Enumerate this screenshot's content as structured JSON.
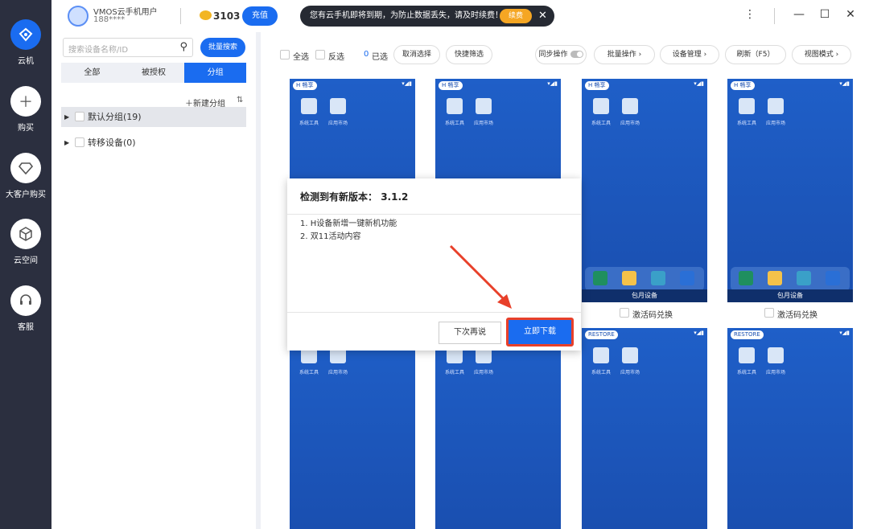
{
  "rail": {
    "items": [
      {
        "label": "云机",
        "icon": "cloud-phone-icon"
      },
      {
        "label": "购买",
        "icon": "plus-icon"
      },
      {
        "label": "大客户购买",
        "icon": "diamond-icon"
      },
      {
        "label": "云空间",
        "icon": "cube-icon"
      },
      {
        "label": "客服",
        "icon": "headset-icon"
      }
    ]
  },
  "topbar": {
    "user_name": "VMOS云手机用户",
    "user_id": "188****",
    "coins": "3103",
    "recharge_label": "充值",
    "notice_text": "您有云手机即将到期，为防止数据丢失，请及时续费！",
    "renew_label": "续费"
  },
  "sidebar": {
    "search_placeholder": "搜索设备名称/ID",
    "batch_search_label": "批量搜索",
    "tabs": [
      "全部",
      "被授权",
      "分组"
    ],
    "new_group_label": "新建分组",
    "groups": [
      {
        "label": "默认分组(19)"
      },
      {
        "label": "转移设备(0)"
      }
    ]
  },
  "toolbar": {
    "select_all": "全选",
    "invert": "反选",
    "selected_count": "0",
    "selected_label": "已选",
    "cancel_select": "取消选择",
    "quick_select": "快捷筛选",
    "sync_op": "同步操作",
    "batch_op": "批量操作",
    "device_manage": "设备管理",
    "refresh": "刷新（F5）",
    "view_mode": "视图模式"
  },
  "phones": {
    "badge_h": "H 畅享",
    "badge_restore": "RESTORE",
    "app1_label": "系统工具",
    "app2_label": "应用市场",
    "footer_label": "包月设备",
    "caption": "激活码兑换"
  },
  "dialog": {
    "title": "检测到有新版本：",
    "version": "3.1.2",
    "lines": [
      "1. H设备新增一键新机功能",
      "2. 双11活动内容"
    ],
    "later_label": "下次再说",
    "download_label": "立即下载"
  },
  "colors": {
    "accent": "#1a6cf0",
    "rail_bg": "#2b2f3f",
    "highlight": "#e8402a"
  }
}
